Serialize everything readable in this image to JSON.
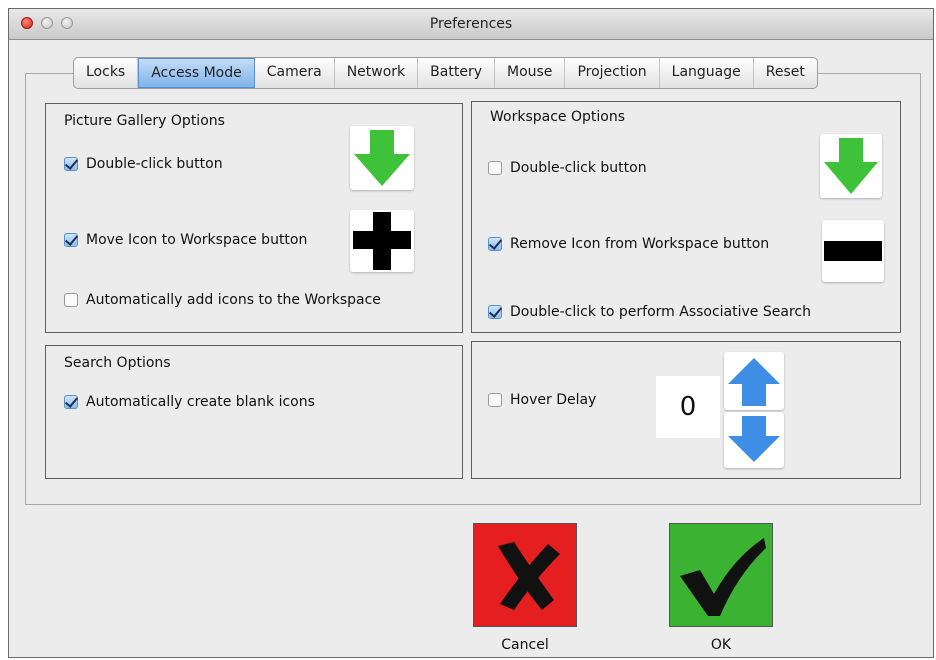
{
  "window": {
    "title": "Preferences"
  },
  "tabs": [
    "Locks",
    "Access Mode",
    "Camera",
    "Network",
    "Battery",
    "Mouse",
    "Projection",
    "Language",
    "Reset"
  ],
  "active_tab": "Access Mode",
  "picture_gallery": {
    "title": "Picture Gallery Options",
    "double_click": {
      "label": "Double-click button",
      "checked": true,
      "icon": "green-down-arrow-icon"
    },
    "move_icon": {
      "label": "Move Icon to Workspace button",
      "checked": true,
      "icon": "plus-icon"
    },
    "auto_add": {
      "label": "Automatically add icons to the Workspace",
      "checked": false
    }
  },
  "workspace": {
    "title": "Workspace Options",
    "double_click": {
      "label": "Double-click button",
      "checked": false,
      "icon": "green-down-arrow-icon"
    },
    "remove_icon": {
      "label": "Remove Icon from Workspace button",
      "checked": true,
      "icon": "minus-icon"
    },
    "associative": {
      "label": "Double-click to perform Associative Search",
      "checked": true
    }
  },
  "search": {
    "title": "Search Options",
    "auto_blank": {
      "label": "Automatically create blank icons",
      "checked": true
    }
  },
  "hover": {
    "label": "Hover Delay",
    "checked": false,
    "value": "0",
    "up_icon": "blue-up-arrow-icon",
    "down_icon": "blue-down-arrow-icon"
  },
  "buttons": {
    "cancel_label": "Cancel",
    "ok_label": "OK"
  },
  "colors": {
    "cancel": "#e51f1f",
    "ok": "#3cb232",
    "arrow_green": "#3ec23a",
    "arrow_blue": "#3e8ee6"
  }
}
